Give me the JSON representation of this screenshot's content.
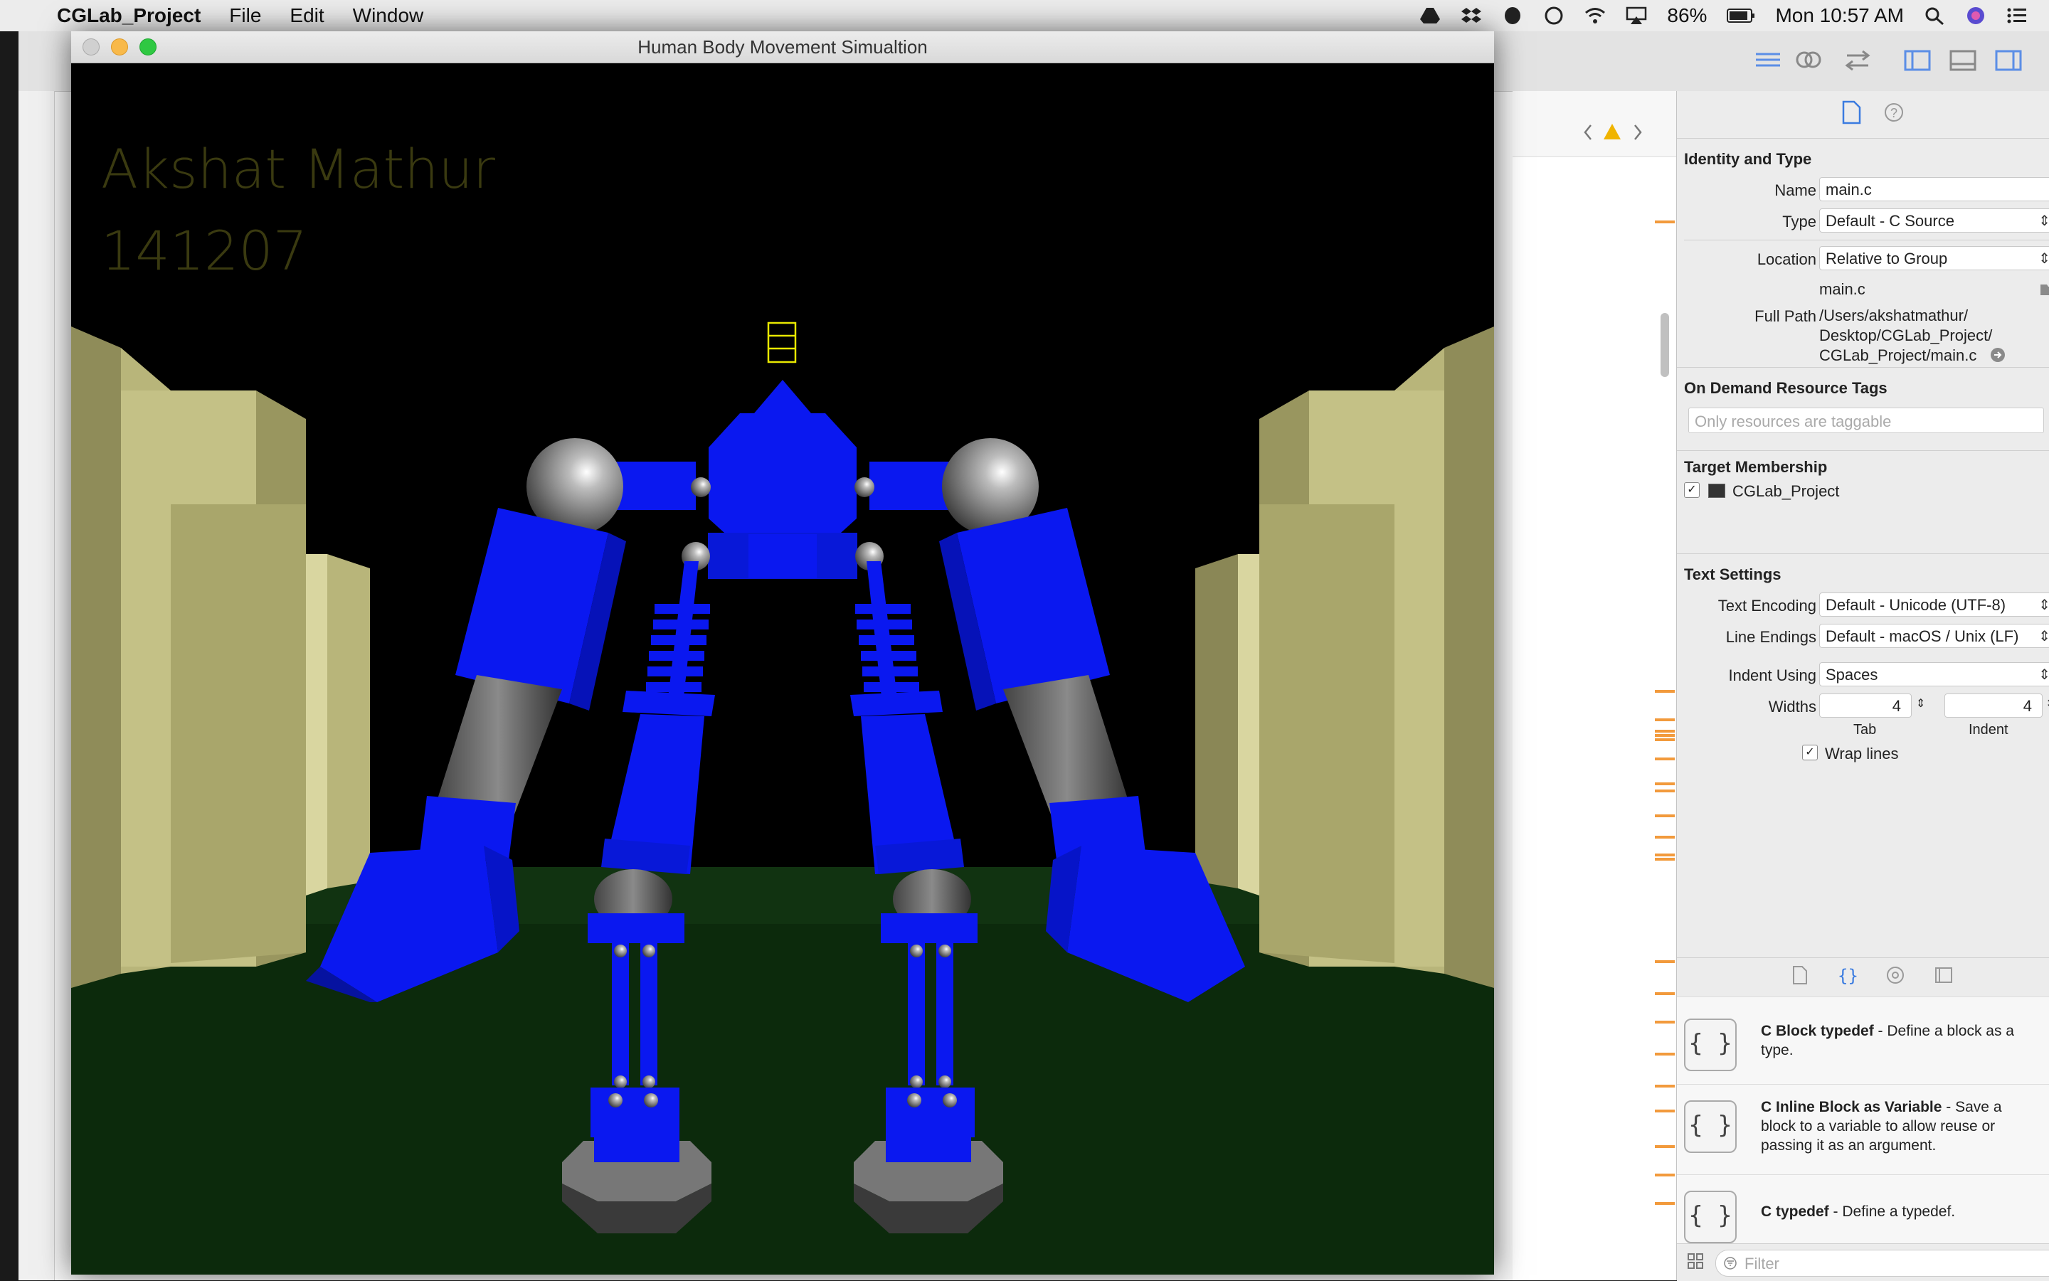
{
  "menubar": {
    "apple": "",
    "app_name": "CGLab_Project",
    "menus": [
      "File",
      "Edit",
      "Window"
    ],
    "battery": "86%",
    "clock": "Mon 10:57 AM"
  },
  "sim_window": {
    "title": "Human Body Movement Simualtion",
    "overlay_name": "Akshat  Mathur",
    "overlay_id": "141207"
  },
  "inspector": {
    "identity": {
      "title": "Identity and Type",
      "name_label": "Name",
      "name_value": "main.c",
      "type_label": "Type",
      "type_value": "Default - C Source",
      "location_label": "Location",
      "location_value": "Relative to Group",
      "file_name": "main.c",
      "full_path_label": "Full Path",
      "full_path_1": "/Users/akshatmathur/",
      "full_path_2": "Desktop/CGLab_Project/",
      "full_path_3": "CGLab_Project/main.c"
    },
    "odr": {
      "title": "On Demand Resource Tags",
      "placeholder": "Only resources are taggable"
    },
    "target": {
      "title": "Target Membership",
      "item": "CGLab_Project",
      "checked": true
    },
    "text_settings": {
      "title": "Text Settings",
      "encoding_label": "Text Encoding",
      "encoding_value": "Default - Unicode (UTF-8)",
      "endings_label": "Line Endings",
      "endings_value": "Default - macOS / Unix (LF)",
      "indent_using_label": "Indent Using",
      "indent_using_value": "Spaces",
      "widths_label": "Widths",
      "tab_value": "4",
      "indent_value": "4",
      "tab_caption": "Tab",
      "indent_caption": "Indent",
      "wrap_label": "Wrap lines",
      "wrap_checked": true
    }
  },
  "library": {
    "snippets": [
      {
        "icon": "{ }",
        "name": "C Block typedef",
        "desc": " - Define a block as a type."
      },
      {
        "icon": "{ }",
        "name": "C Inline Block as Variable",
        "desc": " - Save a block to a variable to allow reuse or passing it as an argument."
      },
      {
        "icon": "{ }",
        "name": "C typedef",
        "desc": " - Define a typedef."
      }
    ],
    "filter_placeholder": "Filter"
  },
  "colors": {
    "robot_blue": "#0a18f0",
    "floor_green": "#0c2a0c",
    "wall_khaki": "#b8b57a",
    "overlay_text": "#3a3a10"
  }
}
